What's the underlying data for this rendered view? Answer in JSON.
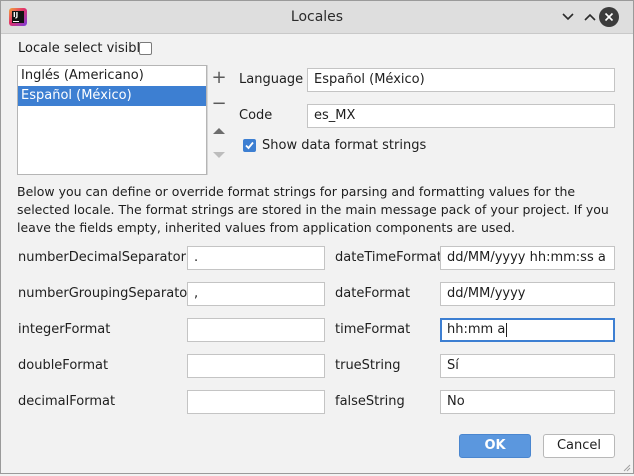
{
  "window": {
    "title": "Locales"
  },
  "locale_select": {
    "label": "Locale select visible",
    "checked": false
  },
  "locales_list": {
    "items": [
      {
        "label": "Inglés (Americano)",
        "selected": false
      },
      {
        "label": "Español (México)",
        "selected": true
      }
    ]
  },
  "list_actions": {
    "add": "+",
    "remove": "−"
  },
  "details": {
    "language_label": "Language",
    "language_value": "Español (México)",
    "code_label": "Code",
    "code_value": "es_MX",
    "show_format_label": "Show data format strings",
    "show_format_checked": true
  },
  "description": "Below you can define or override format strings for parsing and formatting values for the selected locale. The format strings are stored in the main message pack of your project. If you leave the fields empty, inherited values from application components are used.",
  "left_fields": [
    {
      "label": "numberDecimalSeparator",
      "value": "."
    },
    {
      "label": "numberGroupingSeparator",
      "value": ","
    },
    {
      "label": "integerFormat",
      "value": ""
    },
    {
      "label": "doubleFormat",
      "value": ""
    },
    {
      "label": "decimalFormat",
      "value": ""
    }
  ],
  "right_fields": [
    {
      "label": "dateTimeFormat",
      "value": "dd/MM/yyyy hh:mm:ss a"
    },
    {
      "label": "dateFormat",
      "value": "dd/MM/yyyy"
    },
    {
      "label": "timeFormat",
      "value": "hh:mm a"
    },
    {
      "label": "trueString",
      "value": "Sí"
    },
    {
      "label": "falseString",
      "value": "No"
    }
  ],
  "buttons": {
    "ok": "OK",
    "cancel": "Cancel"
  },
  "colors": {
    "accent": "#3d7fd2",
    "ok_button": "#5b97de"
  },
  "icons": [
    "app-icon",
    "minimize-chevron-icon",
    "maximize-chevron-icon",
    "close-icon",
    "move-up-icon",
    "move-down-icon",
    "checkmark-icon"
  ]
}
